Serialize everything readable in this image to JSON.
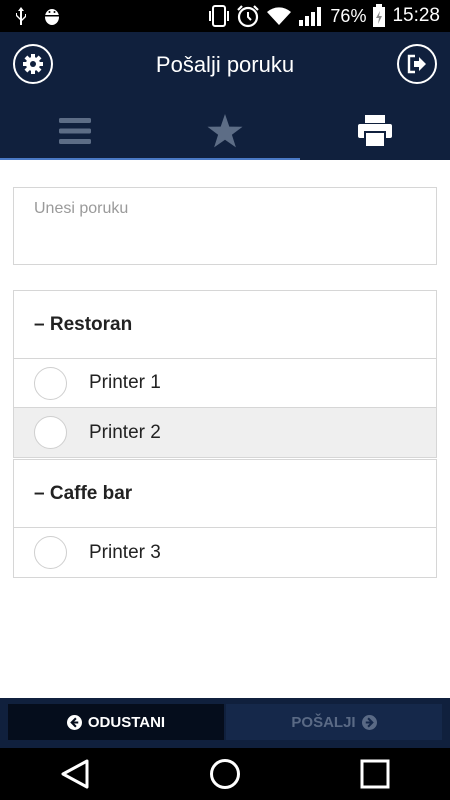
{
  "status_bar": {
    "battery": "76%",
    "time": "15:28",
    "icons": [
      "usb-icon",
      "android-debug-icon",
      "phone-vibrate-icon",
      "alarm-icon",
      "wifi-icon",
      "signal-icon",
      "battery-charging-icon"
    ]
  },
  "header": {
    "title": "Pošalji poruku",
    "left_icon": "settings-gear-icon",
    "right_icon": "logout-icon"
  },
  "tabs": [
    {
      "icon": "menu-bars-icon",
      "active": false
    },
    {
      "icon": "star-icon",
      "active": false
    },
    {
      "icon": "printer-icon",
      "active": true
    }
  ],
  "message": {
    "placeholder": "Unesi poruku",
    "value": ""
  },
  "groups": [
    {
      "label": "– Restoran",
      "printers": [
        {
          "label": "Printer 1",
          "selected": false
        },
        {
          "label": "Printer 2",
          "selected": false
        }
      ]
    },
    {
      "label": "– Caffe bar",
      "printers": [
        {
          "label": "Printer 3",
          "selected": false
        }
      ]
    }
  ],
  "actions": {
    "cancel_label": "ODUSTANI",
    "send_label": "POŠALJI"
  },
  "colors": {
    "header_bg": "#10203d",
    "tab_indicator": "#4a79c6",
    "row_highlight": "#efefef"
  }
}
